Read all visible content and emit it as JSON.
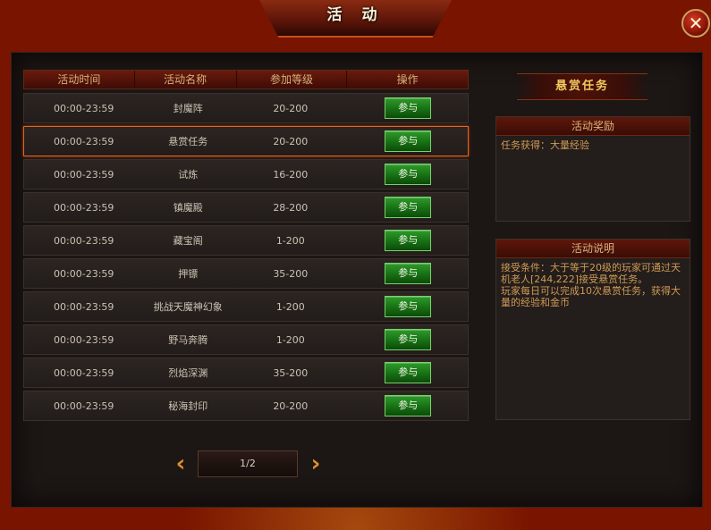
{
  "window": {
    "title": "活 动",
    "close_label": "✕"
  },
  "table": {
    "headers": [
      "活动时间",
      "活动名称",
      "参加等级",
      "操作"
    ],
    "rows": [
      {
        "time": "00:00-23:59",
        "name": "封魔阵",
        "level": "20-200",
        "action": "参与"
      },
      {
        "time": "00:00-23:59",
        "name": "悬赏任务",
        "level": "20-200",
        "action": "参与"
      },
      {
        "time": "00:00-23:59",
        "name": "试炼",
        "level": "16-200",
        "action": "参与"
      },
      {
        "time": "00:00-23:59",
        "name": "镇魔殿",
        "level": "28-200",
        "action": "参与"
      },
      {
        "time": "00:00-23:59",
        "name": "藏宝阁",
        "level": "1-200",
        "action": "参与"
      },
      {
        "time": "00:00-23:59",
        "name": "押镖",
        "level": "35-200",
        "action": "参与"
      },
      {
        "time": "00:00-23:59",
        "name": "挑战天魔神幻象",
        "level": "1-200",
        "action": "参与"
      },
      {
        "time": "00:00-23:59",
        "name": "野马奔腾",
        "level": "1-200",
        "action": "参与"
      },
      {
        "time": "00:00-23:59",
        "name": "烈焰深渊",
        "level": "35-200",
        "action": "参与"
      },
      {
        "time": "00:00-23:59",
        "name": "秘海封印",
        "level": "20-200",
        "action": "参与"
      }
    ]
  },
  "pager": {
    "prev_icon": "arrow-left-icon",
    "next_icon": "arrow-right-icon",
    "page_text": "1/2"
  },
  "detail": {
    "selected_title": "悬赏任务",
    "reward_header": "活动奖励",
    "reward_text": "任务获得：大量经验",
    "desc_header": "活动说明",
    "desc_text": "接受条件：大于等于20级的玩家可通过天机老人[244,222]接受悬赏任务。\n玩家每日可以完成10次悬赏任务，获得大量的经验和金币"
  },
  "colors": {
    "accent": "#e06420",
    "button_green": "#177014",
    "title_gold": "#f2c860",
    "text_orange": "#d09a55"
  }
}
